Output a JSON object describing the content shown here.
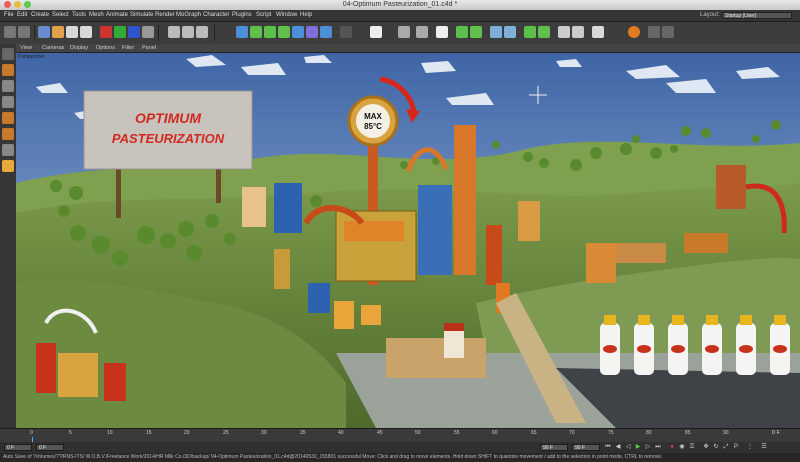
{
  "window": {
    "title": "04-Optimum Pasteurization_01.c4d *"
  },
  "menu": {
    "items": [
      "File",
      "Edit",
      "Create",
      "Select",
      "Tools",
      "Mesh",
      "Animate",
      "Simulate",
      "Render",
      "MoGraph",
      "Character",
      "Plugins",
      "Script",
      "Window",
      "Help"
    ],
    "layout_label": "Layout:",
    "layout_value": "Startup (User)"
  },
  "viewport": {
    "menu": [
      "View",
      "Cameras",
      "Display",
      "Options",
      "Filter",
      "Panel"
    ],
    "label": "Perspective",
    "billboard_line1": "OPTIMUM",
    "billboard_line2": "PASTEURIZATION",
    "gauge_line1": "MAX",
    "gauge_line2": "85°C"
  },
  "timeline": {
    "ticks": [
      "0",
      "5",
      "10",
      "15",
      "20",
      "25",
      "30",
      "35",
      "40",
      "45",
      "50",
      "55",
      "60",
      "65",
      "70",
      "75",
      "80",
      "85",
      "90"
    ],
    "end_label": "0 F"
  },
  "controls": {
    "start_frame": "0 F",
    "current_frame": "0 F",
    "end_frame": "90 F",
    "max_frame": "90 F"
  },
  "status": {
    "text": "Auto Save of '/Volumes/??/RNS-ITS/ W.O.B.V./Freelance Work/2014/HR Milk Co./3D/backup/ 04-Optimum Pasteurization_01.c4d@20140530_155801 successful  Move: Click and drag to move elements. Hold down SHIFT to quantize movement / add to the selection in point mode, CTRL to remove."
  },
  "colors": {
    "sky": "#4f74b0",
    "hills": "#5e7c3a",
    "billboard_text": "#d02a20",
    "gauge_arrow": "#d8261c",
    "bottle_cap": "#e8b41d"
  }
}
